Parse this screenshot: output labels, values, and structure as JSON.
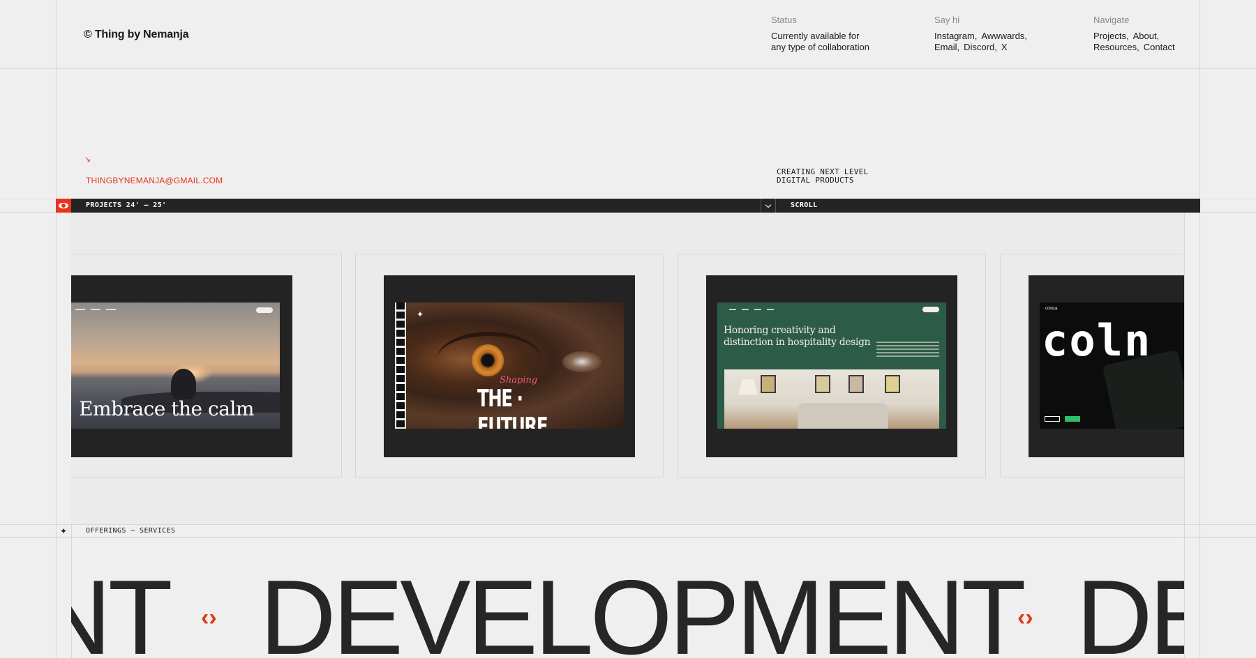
{
  "brand": "© Thing by Nemanja",
  "status": {
    "label": "Status",
    "line1": "Currently available for",
    "line2": "any type of collaboration"
  },
  "say_hi": {
    "label": "Say hi",
    "links": [
      "Instagram,",
      "Awwwards,",
      "Email,",
      "Discord,",
      "X"
    ]
  },
  "navigate": {
    "label": "Navigate",
    "links": [
      "Projects,",
      "About,",
      "Resources,",
      "Contact"
    ]
  },
  "intro": {
    "arrow": "↘",
    "email": "THINGBYNEMANJA@GMAIL.COM",
    "tagline_line1": "CREATING NEXT LEVEL",
    "tagline_line2": "DIGITAL PRODUCTS"
  },
  "projects_bar": {
    "label": "PROJECTS 24' — 25'",
    "scroll": "SCROLL",
    "accent": "#e8341c"
  },
  "projects": [
    {
      "id": "calm",
      "headline": "Embrace the calm"
    },
    {
      "id": "future",
      "headline": "THE · FUTURE",
      "script": "Shaping"
    },
    {
      "id": "hospitality",
      "headline_line1": "Honoring creativity and",
      "headline_line2": "distinction in hospitality design"
    },
    {
      "id": "coinza",
      "tiny": "coinza",
      "headline": "coln"
    }
  ],
  "offerings": {
    "label": "OFFERINGS — SERVICES",
    "star": "✦",
    "marquee_prev": "NT",
    "marquee_main": "DEVELOPMENT",
    "marquee_next": "DE",
    "diamond": "‹›"
  },
  "colors": {
    "accent": "#e8341c",
    "dark": "#242424",
    "bg": "#efefef"
  }
}
